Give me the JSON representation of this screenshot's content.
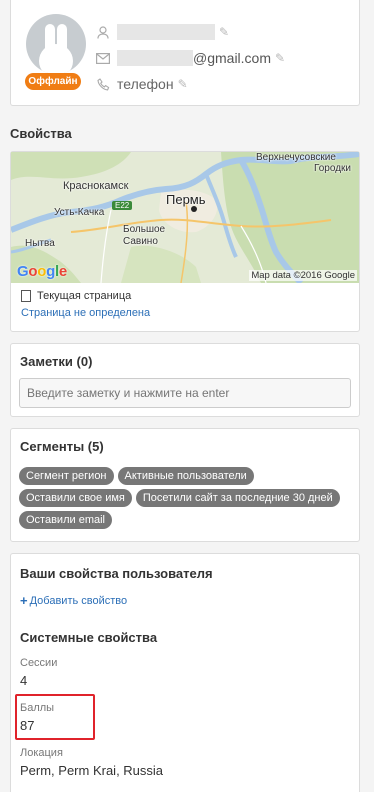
{
  "profile": {
    "status": "Оффлайн",
    "email_domain": "@gmail.com",
    "phone_label": "телефон",
    "status_color": "#f07d14"
  },
  "properties_title": "Свойства",
  "map": {
    "cities": [
      "Верхнечусовские",
      "Городки",
      "Краснокамск",
      "Пермь",
      "Усть-Качка",
      "E22",
      "Большое",
      "Савино",
      "Нытва"
    ],
    "google_letters": [
      "G",
      "o",
      "o",
      "g",
      "l",
      "e"
    ],
    "credit": "Map data ©2016 Google"
  },
  "current_page": {
    "label": "Текущая страница",
    "value": "Страница не определена"
  },
  "notes": {
    "title": "Заметки (0)",
    "placeholder": "Введите заметку и нажмите на enter"
  },
  "segments": {
    "title": "Сегменты (5)",
    "tags": [
      "Сегмент регион",
      "Активные пользователи",
      "Оставили свое имя",
      "Посетили сайт за последние 30 дней",
      "Оставили email"
    ]
  },
  "user_props": {
    "title": "Ваши свойства пользователя",
    "add_label": "Добавить свойство",
    "system_title": "Системные свойства",
    "items": [
      {
        "label": "Сессии",
        "value": "4"
      },
      {
        "label": "Баллы",
        "value": "87"
      },
      {
        "label": "Локация",
        "value": "Perm, Perm Krai, Russia"
      }
    ]
  },
  "colors": {
    "link": "#2c6fb7",
    "tag": "#777777",
    "highlight": "#e0232b"
  }
}
